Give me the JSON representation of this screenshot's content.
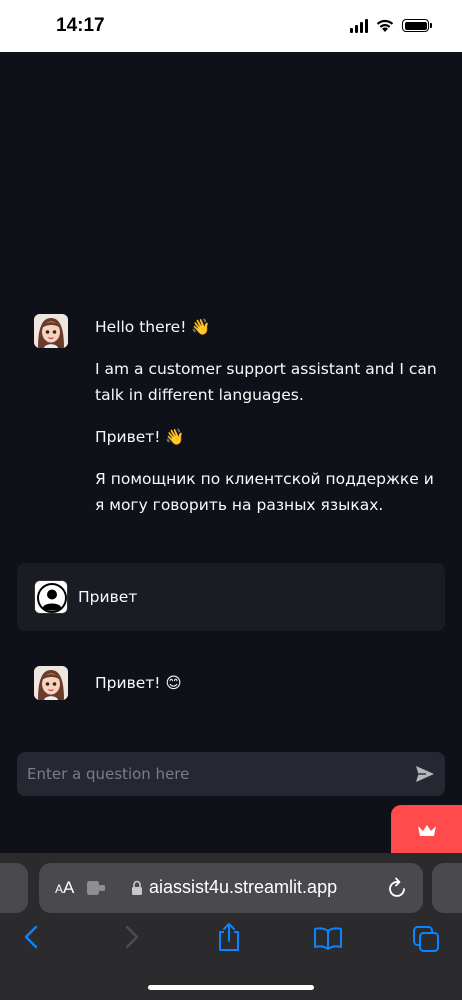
{
  "status_bar": {
    "time": "14:17"
  },
  "messages": [
    {
      "role": "assistant",
      "paragraphs": [
        "Hello there! 👋",
        "I am a customer support assistant and I can talk in different languages.",
        "Привет! 👋",
        "Я помощник по клиентской поддержке и я могу говорить на разных языках."
      ]
    },
    {
      "role": "user",
      "text": "Привет"
    },
    {
      "role": "assistant",
      "text": "Привет! 😊"
    }
  ],
  "chat_input": {
    "placeholder": "Enter a question here"
  },
  "colors": {
    "background": "#0e1117",
    "user_bubble": "#1a1c24",
    "input_bg": "#262730",
    "accent": "#ff4b4b",
    "safari_bar": "#2b2b2e",
    "ios_blue": "#0a84ff"
  },
  "browser": {
    "aa_label": "AA",
    "url": "aiassist4u.streamlit.app"
  }
}
